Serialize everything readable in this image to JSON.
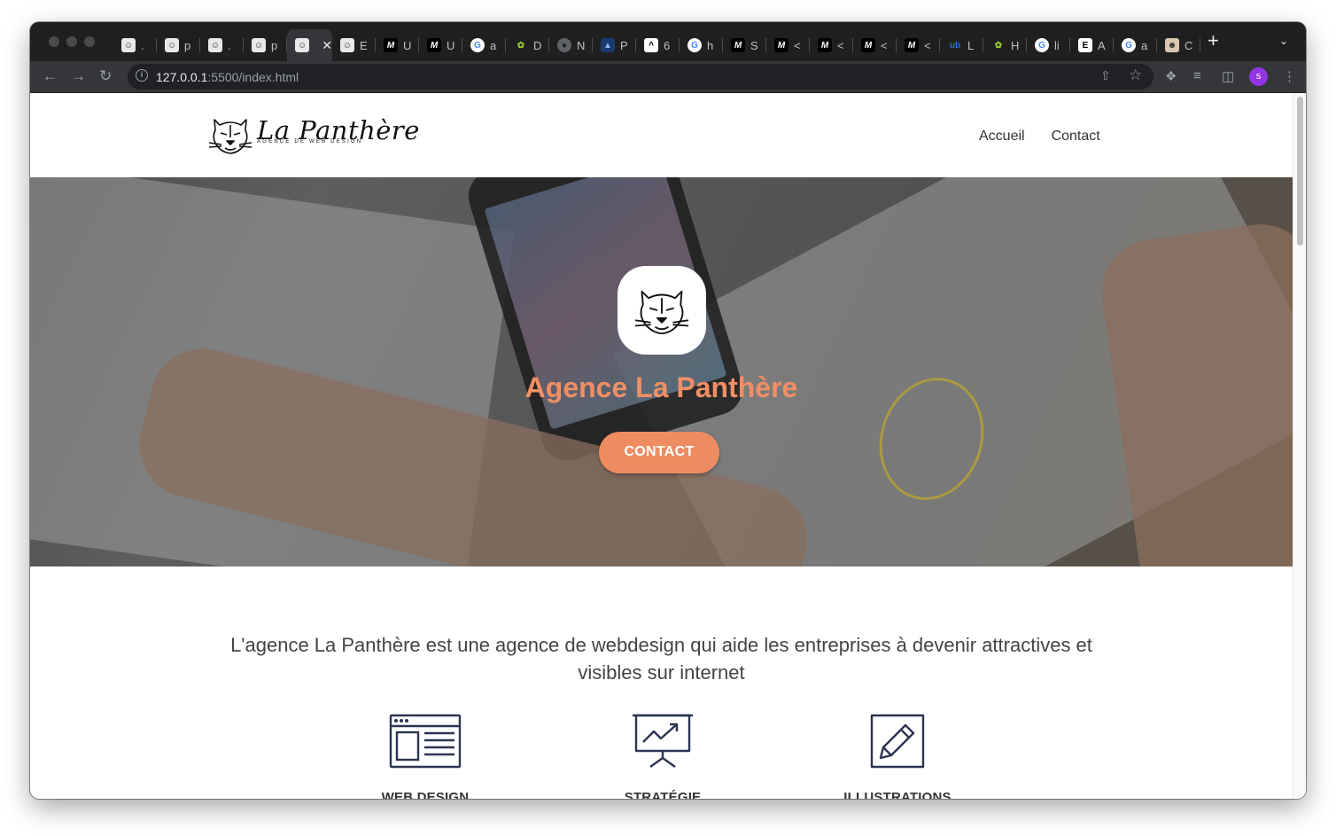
{
  "browser": {
    "tabs": [
      {
        "icon": "panther-favicon",
        "title": "."
      },
      {
        "icon": "panther-favicon",
        "title": "p"
      },
      {
        "icon": "panther-favicon",
        "title": "."
      },
      {
        "icon": "panther-favicon",
        "title": "p"
      },
      {
        "icon": "panther-favicon",
        "title": "",
        "active": true
      },
      {
        "icon": "panther-favicon",
        "title": "E"
      },
      {
        "icon": "medium-favicon",
        "title": "U"
      },
      {
        "icon": "medium-favicon",
        "title": "U"
      },
      {
        "icon": "google-favicon",
        "title": "a"
      },
      {
        "icon": "leaf-favicon",
        "title": "D"
      },
      {
        "icon": "globe-favicon",
        "title": "N"
      },
      {
        "icon": "blue-favicon",
        "title": "P"
      },
      {
        "icon": "arrow-favicon",
        "title": "6"
      },
      {
        "icon": "google-favicon",
        "title": "h"
      },
      {
        "icon": "medium-favicon",
        "title": "S"
      },
      {
        "icon": "medium-favicon",
        "title": "<"
      },
      {
        "icon": "medium-favicon",
        "title": "<"
      },
      {
        "icon": "medium-favicon",
        "title": "<"
      },
      {
        "icon": "medium-favicon",
        "title": "<"
      },
      {
        "icon": "ub-favicon",
        "title": "L"
      },
      {
        "icon": "leaf-favicon",
        "title": "H"
      },
      {
        "icon": "google-favicon",
        "title": "li"
      },
      {
        "icon": "e-favicon",
        "title": "A"
      },
      {
        "icon": "google-favicon",
        "title": "a"
      },
      {
        "icon": "face-favicon",
        "title": "C"
      }
    ],
    "url_host": "127.0.0.1",
    "url_rest": ":5500/index.html",
    "profile_initial": "s"
  },
  "site": {
    "logo": {
      "name": "La Panthère",
      "subtitle": "AGENCE DE WEB DESIGN"
    },
    "nav": [
      {
        "label": "Accueil"
      },
      {
        "label": "Contact"
      }
    ],
    "hero": {
      "title": "Agence La Panthère",
      "button": "CONTACT"
    },
    "intro": "L'agence La Panthère est une agence de webdesign qui aide les entreprises à devenir attractives et visibles sur internet",
    "services": [
      {
        "label": "WEB DESIGN",
        "icon": "web-layout-icon"
      },
      {
        "label": "STRATÉGIE",
        "icon": "presentation-chart-icon"
      },
      {
        "label": "ILLUSTRATIONS",
        "icon": "pencil-icon"
      }
    ]
  },
  "colors": {
    "accent": "#ee8c61",
    "hero_title": "#f08f65",
    "icon_navy": "#2d3452"
  }
}
